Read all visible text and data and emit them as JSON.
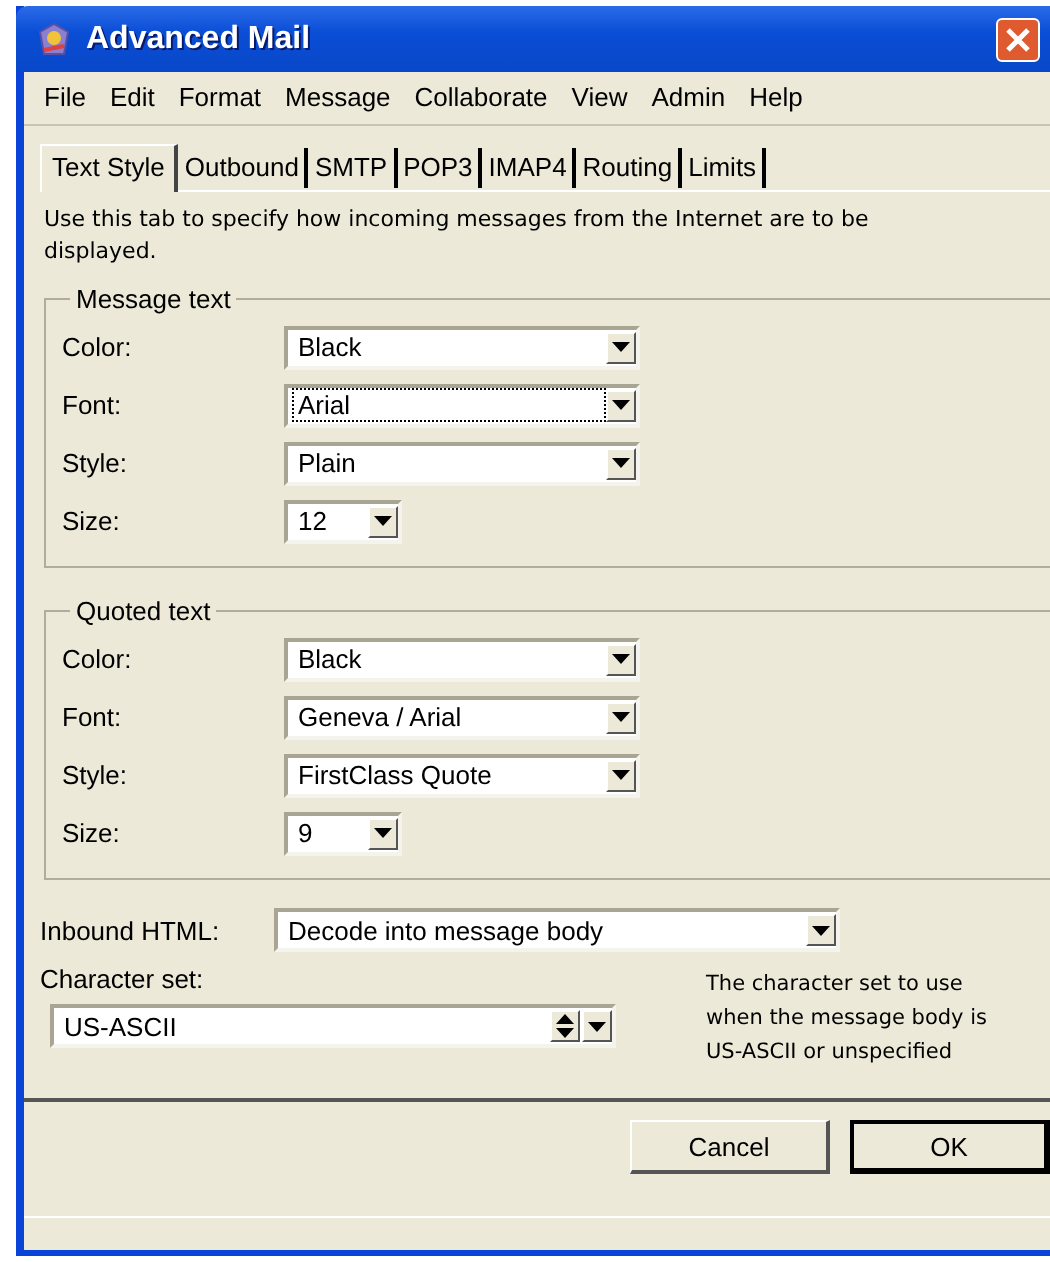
{
  "window": {
    "title": "Advanced Mail"
  },
  "menu": [
    "File",
    "Edit",
    "Format",
    "Message",
    "Collaborate",
    "View",
    "Admin",
    "Help"
  ],
  "tabs": [
    {
      "label": "Text Style",
      "selected": true
    },
    {
      "label": "Outbound",
      "selected": false
    },
    {
      "label": "SMTP",
      "selected": false
    },
    {
      "label": "POP3",
      "selected": false
    },
    {
      "label": "IMAP4",
      "selected": false
    },
    {
      "label": "Routing",
      "selected": false
    },
    {
      "label": "Limits",
      "selected": false
    }
  ],
  "description": "Use this tab to specify how incoming messages from the Internet are to be displayed.",
  "groups": [
    {
      "title": "Message text",
      "fields": [
        {
          "label": "Color:",
          "value": "Black",
          "kind": "wide",
          "focused": false
        },
        {
          "label": "Font:",
          "value": "Arial",
          "kind": "wide",
          "focused": true
        },
        {
          "label": "Style:",
          "value": "Plain",
          "kind": "wide",
          "focused": false
        },
        {
          "label": "Size:",
          "value": "12",
          "kind": "narrow",
          "focused": false
        }
      ]
    },
    {
      "title": "Quoted text",
      "fields": [
        {
          "label": "Color:",
          "value": "Black",
          "kind": "wide",
          "focused": false
        },
        {
          "label": "Font:",
          "value": "Geneva / Arial",
          "kind": "wide",
          "focused": false
        },
        {
          "label": "Style:",
          "value": "FirstClass Quote",
          "kind": "wide",
          "focused": false
        },
        {
          "label": "Size:",
          "value": "9",
          "kind": "narrow",
          "focused": false
        }
      ]
    }
  ],
  "inbound_html": {
    "label": "Inbound HTML:",
    "value": "Decode into message body"
  },
  "character_set": {
    "label": "Character set:",
    "value": "US-ASCII",
    "note": "The character set to use when the message body is US-ASCII or unspecified"
  },
  "buttons": [
    {
      "label": "Cancel",
      "default": false
    },
    {
      "label": "OK",
      "default": true
    }
  ]
}
